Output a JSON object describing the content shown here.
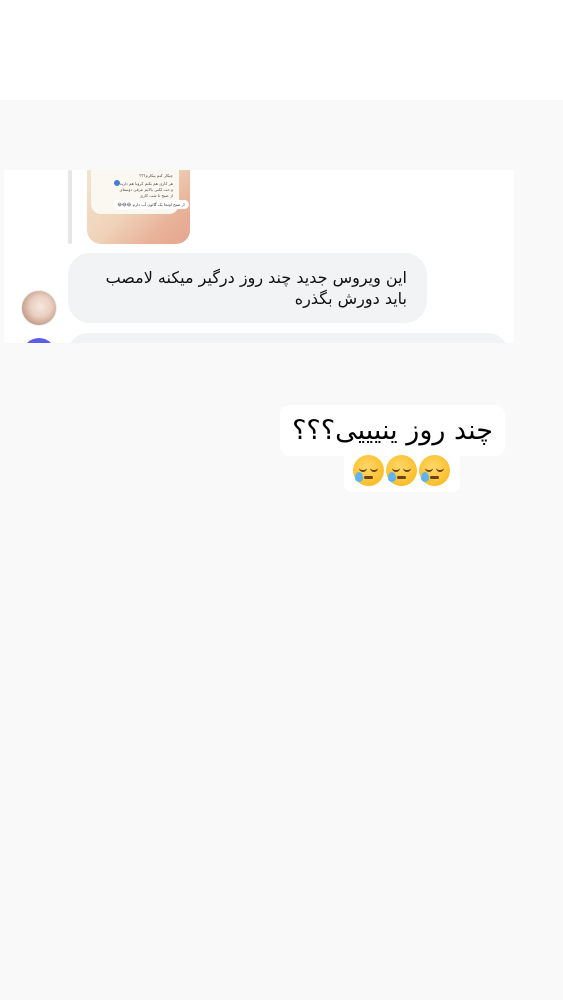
{
  "thumbnail": {
    "lines": [
      "چیکار کنم بیکارم؟؟؟",
      "هر کاری هم بکنم کرونا هم دارید",
      "و حت لکتی بالایم عرفی دوستای",
      "از صبح تا شب کاری"
    ],
    "bottom_pill": "از صبح اونجا یک گالون آب دارم 😂😂😂"
  },
  "chat": {
    "message_line1": "این ویروس جدید چند روز درگیر میکنه لامصب",
    "message_line2": "باید دورش بگذره"
  },
  "caption": {
    "line1": "چند روز ینیییی؟؟؟"
  },
  "emojis": [
    "sleepy-face-emoji",
    "sleepy-face-emoji",
    "sleepy-face-emoji"
  ]
}
